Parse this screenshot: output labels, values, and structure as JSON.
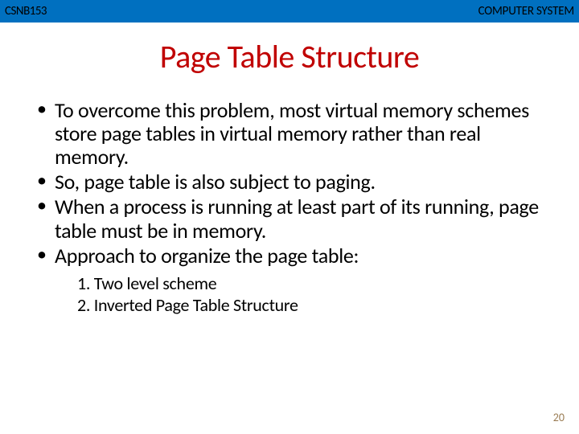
{
  "header": {
    "left": "CSNB153",
    "right": "COMPUTER SYSTEM"
  },
  "title": "Page Table Structure",
  "bullets": [
    "To overcome this problem, most virtual memory schemes store page tables in virtual memory rather than real memory.",
    "So, page table is also subject to paging.",
    "When a process is running at least part of its running, page table must be in memory.",
    "Approach to organize the page table:"
  ],
  "numbered": [
    "1. Two level scheme",
    "2. Inverted Page Table Structure"
  ],
  "page_number": "20"
}
